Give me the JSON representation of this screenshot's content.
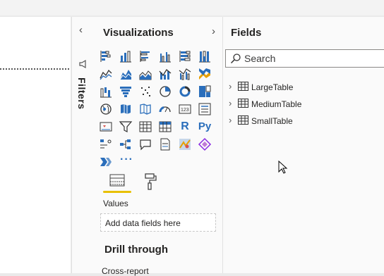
{
  "filters": {
    "label": "Filters",
    "collapse_icon": "chevron-left-icon"
  },
  "visualizations": {
    "title": "Visualizations",
    "expand_icon": "chevron-right-icon",
    "icons": [
      "stacked-bar-chart-icon",
      "stacked-column-chart-icon",
      "clustered-bar-chart-icon",
      "clustered-column-chart-icon",
      "100-stacked-bar-chart-icon",
      "100-stacked-column-chart-icon",
      "line-chart-icon",
      "area-chart-icon",
      "stacked-area-chart-icon",
      "line-and-stacked-column-chart-icon",
      "line-and-clustered-column-chart-icon",
      "ribbon-chart-icon",
      "waterfall-chart-icon",
      "funnel-chart-icon",
      "scatter-chart-icon",
      "pie-chart-icon",
      "donut-chart-icon",
      "treemap-icon",
      "map-icon",
      "filled-map-icon",
      "shape-map-icon",
      "gauge-icon",
      "card-icon",
      "multi-row-card-icon",
      "kpi-icon",
      "slicer-icon",
      "table-icon",
      "matrix-icon",
      "r-script-visual-icon",
      "python-visual-icon",
      "key-influencers-icon",
      "decomposition-tree-icon",
      "qa-icon",
      "paginated-report-icon",
      "arcgis-map-icon",
      "power-apps-icon",
      "smart-narrative-icon"
    ],
    "r_text": "R",
    "py_text": "Py",
    "more": "···",
    "tabs": [
      "fields-tab-icon",
      "format-paint-roller-icon"
    ],
    "values_label": "Values",
    "add_fields_placeholder": "Add data fields here",
    "drill_through_title": "Drill through",
    "cross_report": "Cross-report"
  },
  "fields": {
    "title": "Fields",
    "search_placeholder": "Search",
    "tables": [
      "LargeTable",
      "MediumTable",
      "SmallTable"
    ]
  },
  "colors": {
    "accent_yellow": "#e8c000",
    "icon_blue": "#2a6ebb",
    "icon_dark": "#333333"
  }
}
